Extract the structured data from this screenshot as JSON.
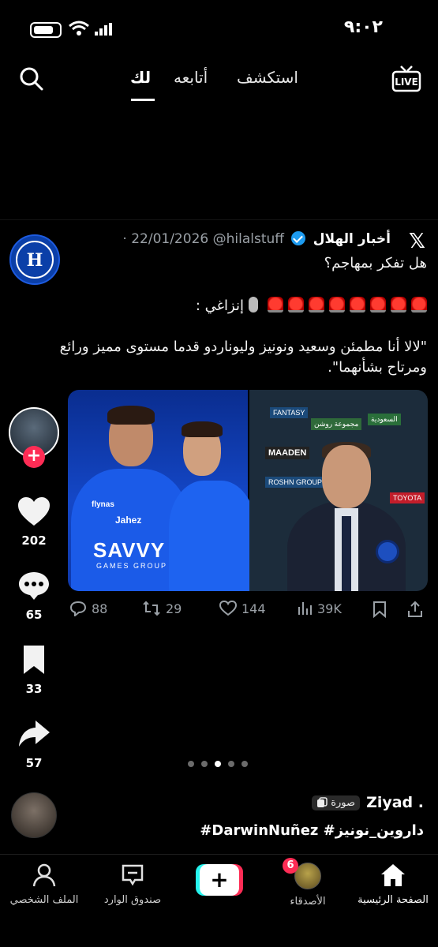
{
  "status_bar": {
    "time": "٩:٠٢"
  },
  "top_nav": {
    "tabs": [
      {
        "label": "لك",
        "active": true
      },
      {
        "label": "أتابعه",
        "active": false
      },
      {
        "label": "استكشف",
        "active": false
      }
    ],
    "live_label": "LIVE"
  },
  "tweet": {
    "display_name": "أخبار الهلال",
    "handle": "@hilalstuff",
    "date": "· 22/01/2026",
    "line1": "هل تفكر بمهاجم؟",
    "line2_suffix": "إنزاغي :",
    "line3": "\"لالا أنا مطمئن وسعيد ونونيز وليوناردو قدما مستوى مميز ورائع ومرتاح بشأنهما\".",
    "media_left": {
      "shirt_sponsor": "SAVVY",
      "shirt_sponsor_sub": "GAMES GROUP",
      "sleeve_brand": "flynas",
      "chest_brand": "Jahez"
    },
    "media_right": {
      "banners": [
        "FANTASY",
        "ROSHN GROUP",
        "MAADEN",
        "TOYOTA",
        "مجموعة روشن",
        "السعودية"
      ]
    },
    "actions": {
      "replies": "88",
      "retweets": "29",
      "likes": "144",
      "views": "39K"
    }
  },
  "rail": {
    "likes": "202",
    "comments": "65",
    "saves": "33",
    "shares": "57"
  },
  "carousel": {
    "total": 5,
    "active_index": 2
  },
  "caption": {
    "username": "Ziyad .",
    "badge": "صورة",
    "tags": "#DarwinNuñez #داروين_نونيز"
  },
  "bottom_nav": {
    "home": "الصفحة الرئيسية",
    "friends": "الأصدقاء",
    "friends_badge": "6",
    "inbox": "صندوق الوارد",
    "profile": "الملف الشخصي"
  },
  "colors": {
    "accent": "#fe2c55",
    "cyan": "#25f4ee",
    "verified": "#1d9bf0",
    "hilal_blue": "#1447c7"
  }
}
